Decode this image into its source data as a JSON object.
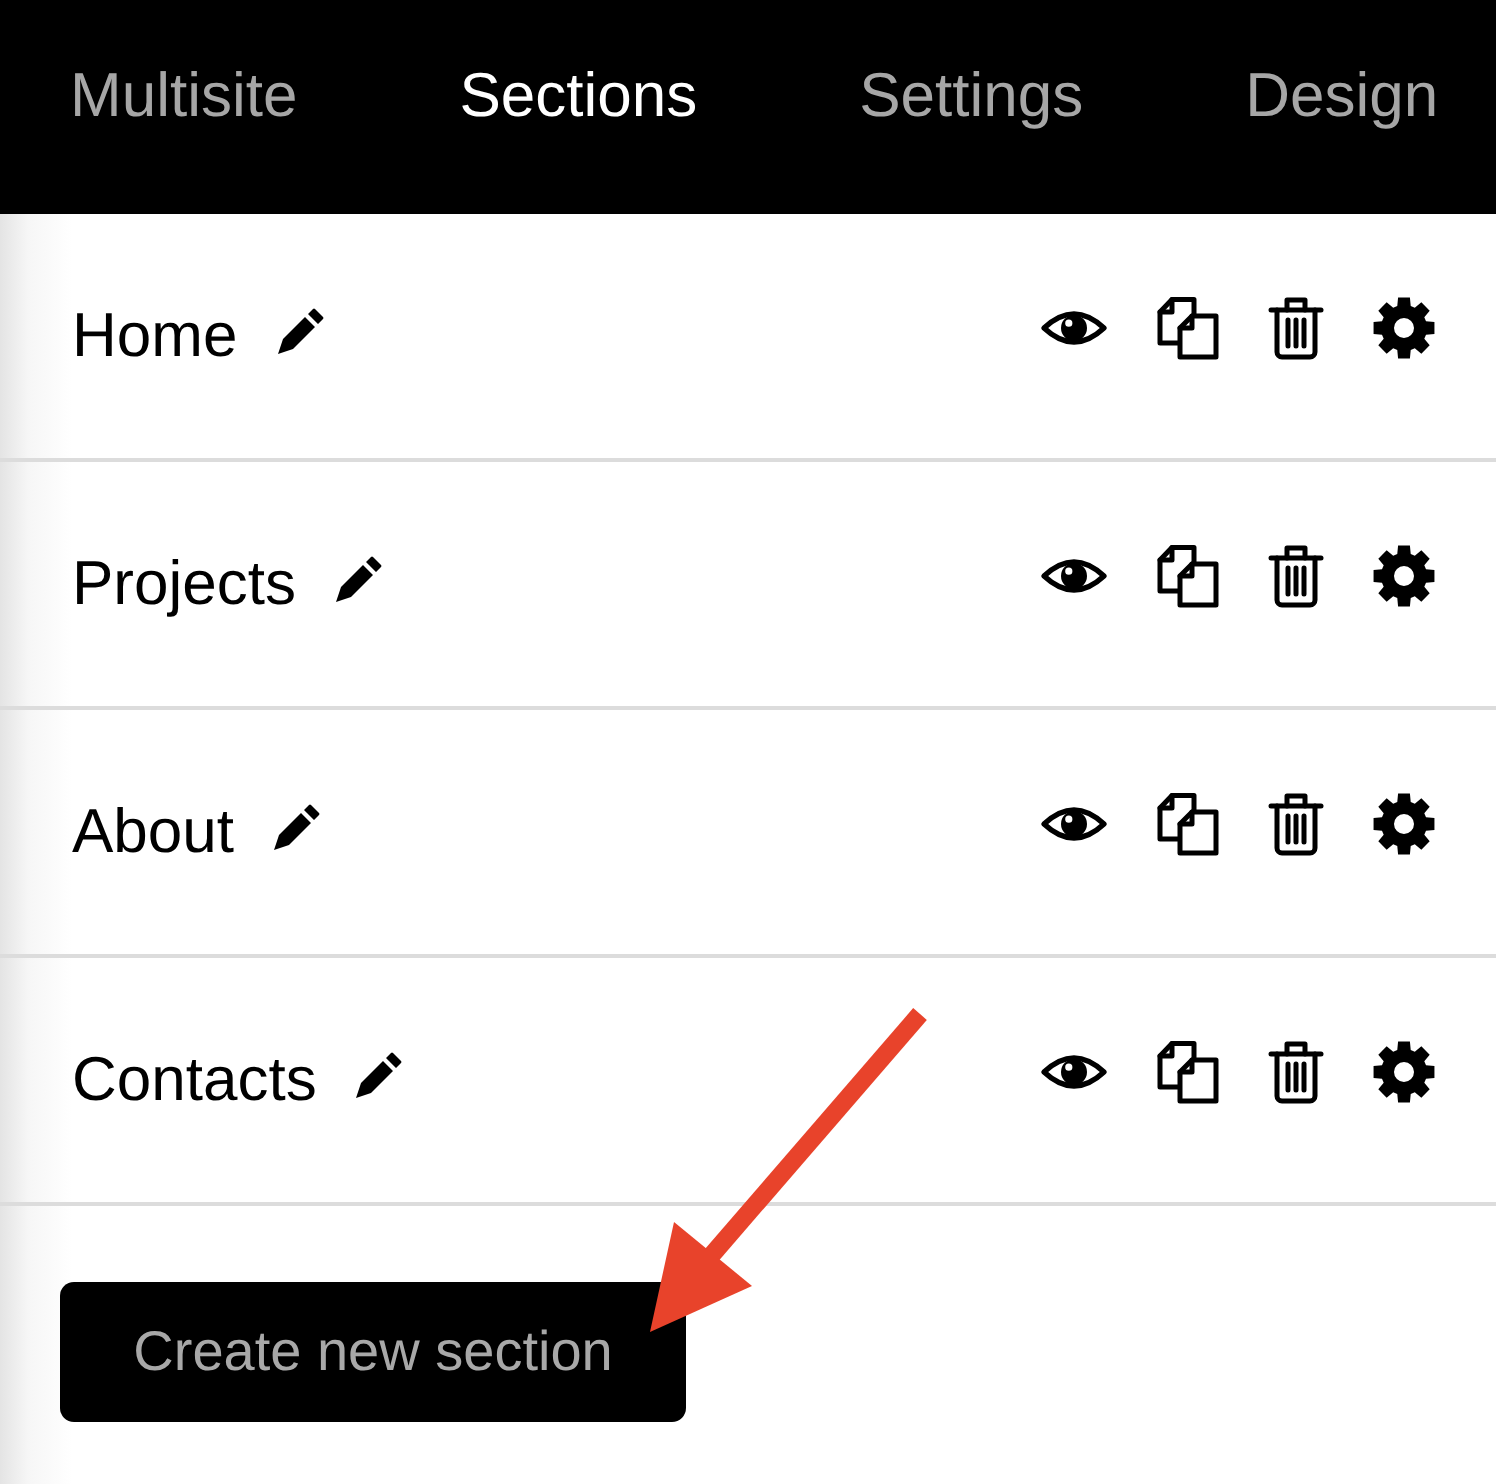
{
  "nav": {
    "tabs": [
      {
        "label": "Multisite",
        "selected": false
      },
      {
        "label": "Sections",
        "selected": true
      },
      {
        "label": "Settings",
        "selected": false
      },
      {
        "label": "Design",
        "selected": false
      }
    ]
  },
  "sections": [
    {
      "name": "Home"
    },
    {
      "name": "Projects"
    },
    {
      "name": "About"
    },
    {
      "name": "Contacts"
    }
  ],
  "create_button": {
    "label": "Create new section"
  }
}
